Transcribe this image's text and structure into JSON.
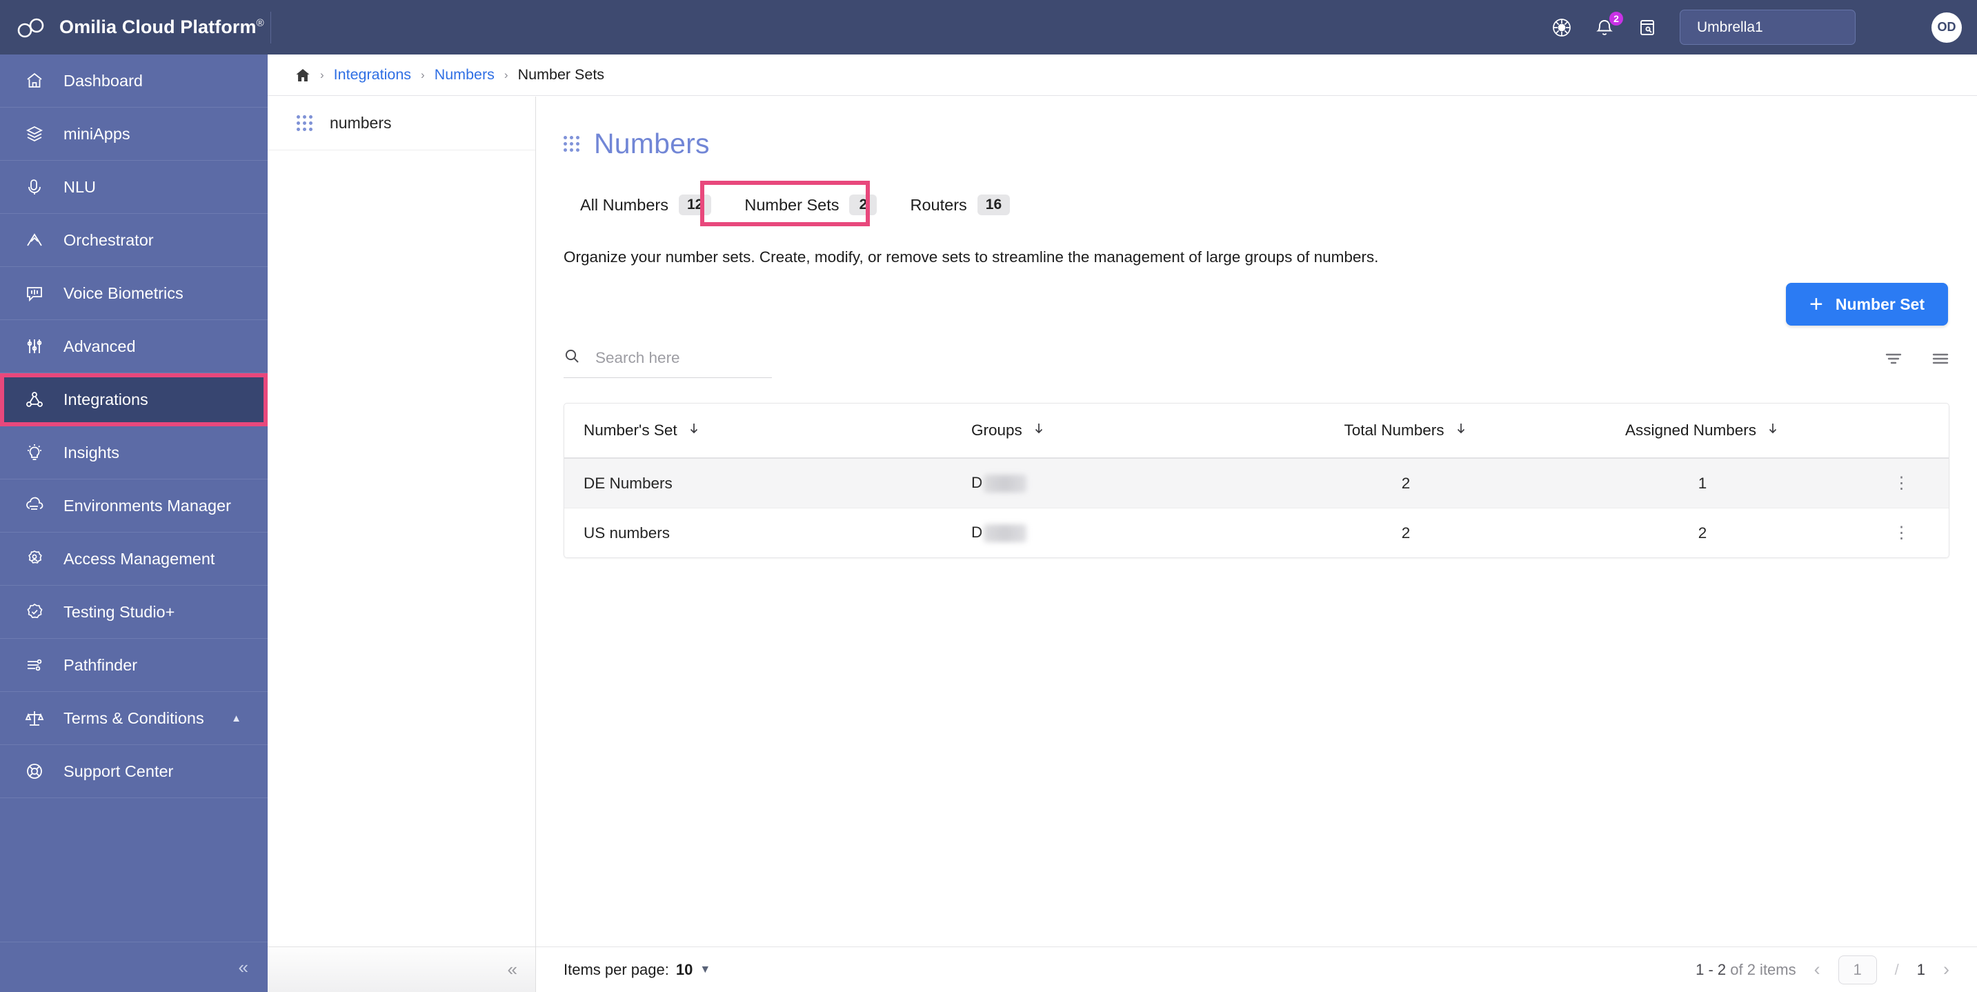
{
  "topbar": {
    "brand": "Omilia Cloud Platform",
    "brand_mark": "®",
    "icons": [
      {
        "name": "theme-icon",
        "glyph": "theme"
      },
      {
        "name": "notifications-icon",
        "glyph": "bell",
        "badge": "2"
      },
      {
        "name": "notes-icon",
        "glyph": "note"
      }
    ],
    "environment": "Umbrella1",
    "avatar_initials": "OD"
  },
  "sidebar": {
    "items": [
      {
        "label": "Dashboard",
        "icon": "home-icon"
      },
      {
        "label": "miniApps",
        "icon": "layers-icon"
      },
      {
        "label": "NLU",
        "icon": "microphone-icon"
      },
      {
        "label": "Orchestrator",
        "icon": "flow-icon"
      },
      {
        "label": "Voice Biometrics",
        "icon": "voiceprint-icon"
      },
      {
        "label": "Advanced",
        "icon": "sliders-icon"
      },
      {
        "label": "Integrations",
        "icon": "integrations-icon",
        "active": true,
        "highlighted": true
      },
      {
        "label": "Insights",
        "icon": "lightbulb-icon"
      },
      {
        "label": "Environments Manager",
        "icon": "cloud-icon"
      },
      {
        "label": "Access Management",
        "icon": "user-gear-icon"
      },
      {
        "label": "Testing Studio+",
        "icon": "badge-check-icon"
      },
      {
        "label": "Pathfinder",
        "icon": "pathfinder-icon"
      },
      {
        "label": "Terms & Conditions",
        "icon": "scales-icon",
        "caret": "▲"
      },
      {
        "label": "Support Center",
        "icon": "lifebuoy-icon"
      }
    ],
    "collapse_glyph": "«"
  },
  "breadcrumb": {
    "home_icon": "home-icon",
    "separator": "›",
    "items": [
      {
        "label": "Integrations",
        "link": true
      },
      {
        "label": "Numbers",
        "link": true
      },
      {
        "label": "Number Sets",
        "link": false
      }
    ]
  },
  "tree_panel": {
    "items": [
      {
        "label": "numbers",
        "icon": "grid-dots-icon"
      }
    ],
    "collapse_glyph": "«"
  },
  "main": {
    "title": "Numbers",
    "title_icon": "grid-dots-icon",
    "tabs": [
      {
        "label": "All Numbers",
        "count": "12",
        "selected": false
      },
      {
        "label": "Number Sets",
        "count": "2",
        "selected": true,
        "highlighted": true
      },
      {
        "label": "Routers",
        "count": "16",
        "selected": false
      }
    ],
    "description": "Organize your number sets. Create, modify, or remove sets to streamline the management of large groups of numbers.",
    "primary_button": {
      "label": "Number Set",
      "icon": "plus-icon"
    },
    "search": {
      "placeholder": "Search here",
      "value": "",
      "icon": "search-icon"
    },
    "tool_icons": [
      {
        "name": "filter-icon"
      },
      {
        "name": "list-view-icon"
      }
    ],
    "table": {
      "columns": [
        {
          "label": "Number's Set",
          "sort_icon": "arrow-down-icon"
        },
        {
          "label": "Groups",
          "sort_icon": "arrow-down-icon"
        },
        {
          "label": "Total Numbers",
          "sort_icon": "arrow-down-icon"
        },
        {
          "label": "Assigned Numbers",
          "sort_icon": "arrow-down-icon"
        }
      ],
      "rows": [
        {
          "set": "DE Numbers",
          "group_prefix": "D",
          "group_redacted": true,
          "total": "2",
          "assigned": "1",
          "menu_icon": "kebab-menu-icon"
        },
        {
          "set": "US numbers",
          "group_prefix": "D",
          "group_redacted": true,
          "total": "2",
          "assigned": "2",
          "menu_icon": "kebab-menu-icon"
        }
      ]
    },
    "footer": {
      "items_per_page_label": "Items per page:",
      "items_per_page_value": "10",
      "dropdown_glyph": "▼",
      "range_text": "1 - 2",
      "range_total": "of 2 items",
      "prev_glyph": "‹",
      "next_glyph": "›",
      "current_page": "1",
      "slash": "/",
      "total_pages": "1"
    }
  },
  "colors": {
    "brand_bar": "#3e4a70",
    "sidebar": "#5c6ba6",
    "sidebar_active": "#374570",
    "highlight": "#e8487c",
    "accent_blue": "#2b7bf3",
    "title_blue": "#7186d6",
    "link_blue": "#2f6fe4",
    "badge_purple": "#c832e6"
  }
}
